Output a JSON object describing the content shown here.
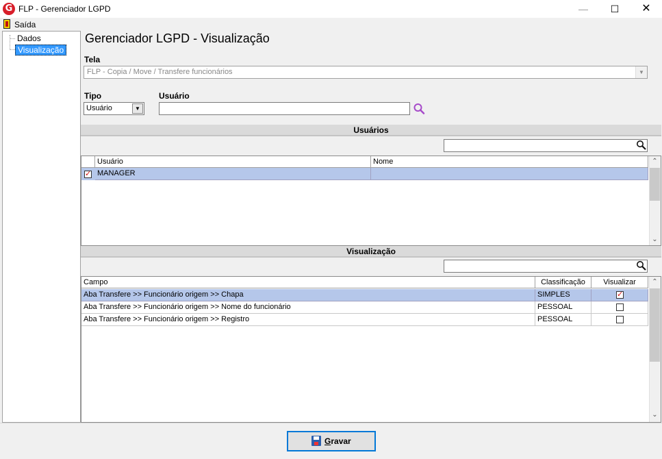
{
  "window": {
    "title": "FLP - Gerenciador LGPD",
    "logo_letter": "G",
    "minimize": "—",
    "maximize": "☐",
    "close": "✕"
  },
  "menu": {
    "exit_label": "Saída"
  },
  "tree": {
    "items": [
      {
        "label": "Dados"
      },
      {
        "label": "Visualização",
        "selected": true
      }
    ]
  },
  "main": {
    "title": "Gerenciador LGPD - Visualização",
    "tela_label": "Tela",
    "tela_value": "FLP - Copia / Move / Transfere funcionários",
    "tipo_label": "Tipo",
    "tipo_value": "Usuário",
    "usuario_label": "Usuário",
    "usuario_value": ""
  },
  "users_section": {
    "header": "Usuários",
    "filter_value": "",
    "columns": [
      "Usuário",
      "Nome"
    ],
    "rows": [
      {
        "checked": true,
        "usuario": "MANAGER",
        "nome": ""
      }
    ]
  },
  "fields_section": {
    "header": "Visualização",
    "filter_value": "",
    "columns": [
      "Campo",
      "Classificação",
      "Visualizar"
    ],
    "rows": [
      {
        "campo": "Aba Transfere >> Funcionário origem >> Chapa",
        "classificacao": "SIMPLES",
        "visualizar": true
      },
      {
        "campo": "Aba Transfere >> Funcionário origem >> Nome do funcionário",
        "classificacao": "PESSOAL",
        "visualizar": false
      },
      {
        "campo": "Aba Transfere >> Funcionário origem >> Registro",
        "classificacao": "PESSOAL",
        "visualizar": false
      }
    ]
  },
  "footer": {
    "save_label_first": "G",
    "save_label_rest": "ravar"
  },
  "colors": {
    "selection": "#b5c7ea",
    "accent": "#0078d7",
    "logo": "#d81e2a",
    "search_icon": "#a64ac9"
  }
}
